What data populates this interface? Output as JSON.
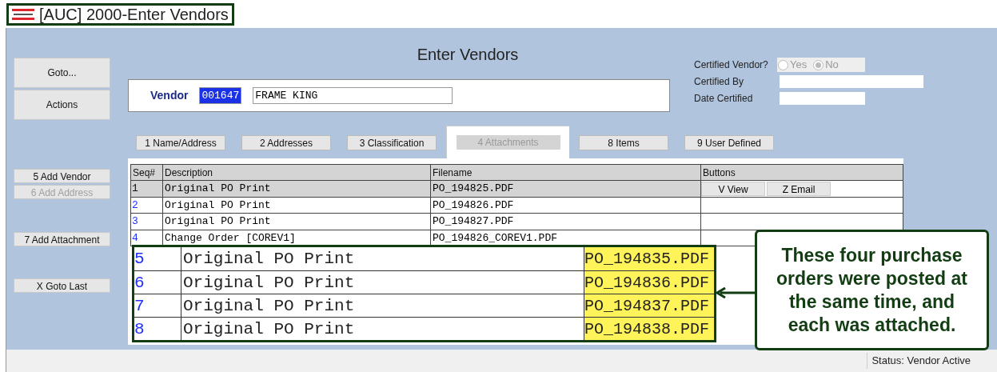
{
  "window": {
    "title": "[AUC] 2000-Enter Vendors"
  },
  "heading": "Enter Vendors",
  "left_buttons": [
    {
      "label": "Goto...",
      "kind": "large",
      "disabled": false
    },
    {
      "label": "Actions",
      "kind": "large",
      "disabled": false
    },
    {
      "label": "5 Add Vendor",
      "kind": "small",
      "disabled": false
    },
    {
      "label": "6 Add Address",
      "kind": "small",
      "disabled": true
    },
    {
      "label": "7 Add Attachment",
      "kind": "small",
      "disabled": false
    },
    {
      "label": "X Goto Last",
      "kind": "small",
      "disabled": false
    }
  ],
  "vendor": {
    "label": "Vendor",
    "id": "001647",
    "name": "FRAME KING"
  },
  "certified": {
    "label": "Certified Vendor?",
    "options": [
      {
        "label": "Yes",
        "selected": false
      },
      {
        "label": "No",
        "selected": true
      }
    ],
    "fields": [
      {
        "label": "Certified By"
      },
      {
        "label": "Date Certified"
      }
    ]
  },
  "tabs": [
    {
      "label": "1 Name/Address",
      "selected": false
    },
    {
      "label": "2 Addresses",
      "selected": false
    },
    {
      "label": "3 Classification",
      "selected": false
    },
    {
      "label": "4 Attachments",
      "selected": true
    },
    {
      "label": "8 Items",
      "selected": false
    },
    {
      "label": "9 User Defined",
      "selected": false
    }
  ],
  "table": {
    "columns": [
      "Seq#",
      "Description",
      "Filename",
      "Buttons"
    ],
    "rows": [
      {
        "seq": "1",
        "description": "Original PO Print",
        "filename": "PO_194825.PDF",
        "selected": true
      },
      {
        "seq": "2",
        "description": "Original PO Print",
        "filename": "PO_194826.PDF",
        "selected": false
      },
      {
        "seq": "3",
        "description": "Original PO Print",
        "filename": "PO_194827.PDF",
        "selected": false
      },
      {
        "seq": "4",
        "description": "Change Order [COREV1]",
        "filename": "PO_194826_COREV1.PDF",
        "selected": false
      }
    ],
    "row_buttons": [
      "V View",
      "Z Email"
    ]
  },
  "magnified_rows": [
    {
      "seq": "5",
      "description": "Original PO Print",
      "filename": "PO_194835.PDF"
    },
    {
      "seq": "6",
      "description": "Original PO Print",
      "filename": "PO_194836.PDF"
    },
    {
      "seq": "7",
      "description": "Original PO Print",
      "filename": "PO_194837.PDF"
    },
    {
      "seq": "8",
      "description": "Original PO Print",
      "filename": "PO_194838.PDF"
    }
  ],
  "callout": "These four purchase orders were posted at the same time, and each was attached.",
  "status_bar": "Status: Vendor Active"
}
